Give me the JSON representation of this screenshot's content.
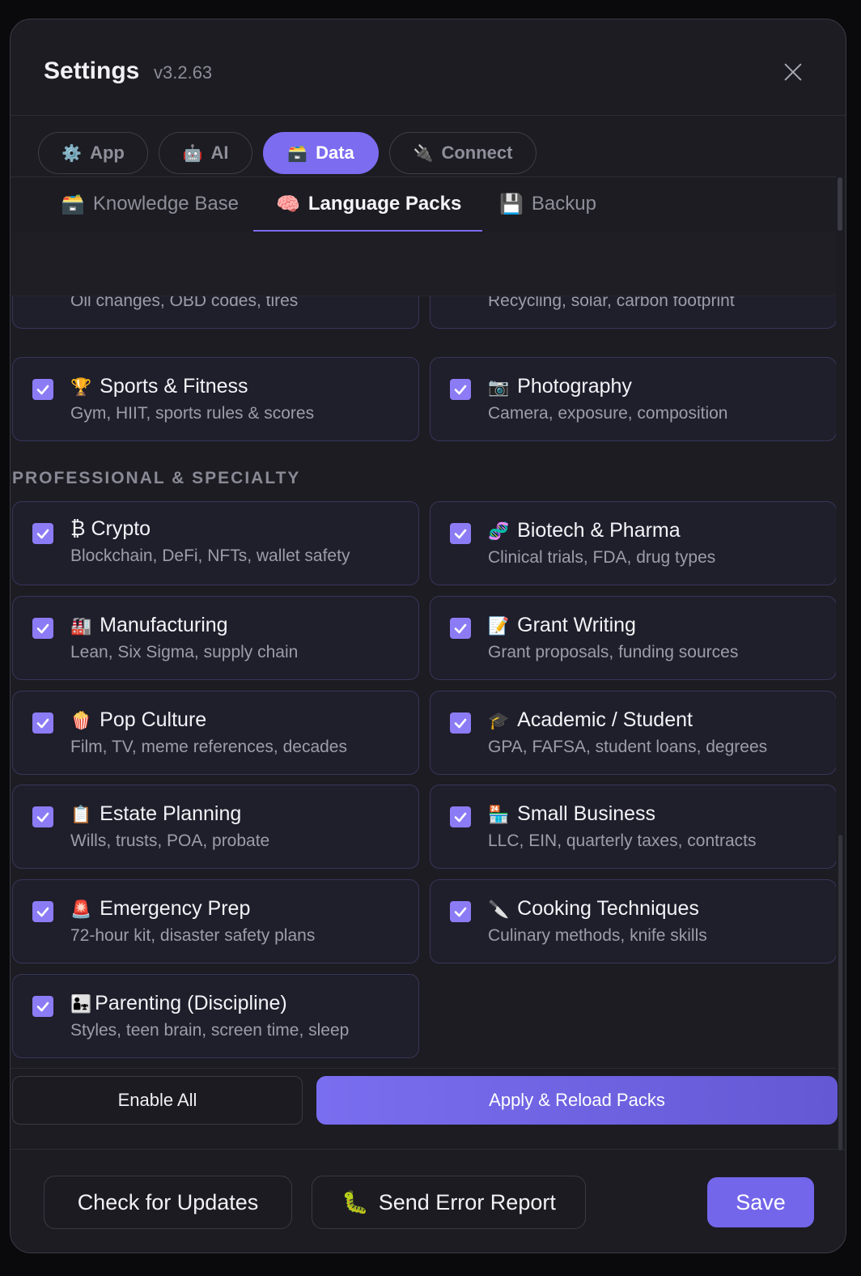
{
  "header": {
    "title": "Settings",
    "version": "v3.2.63"
  },
  "main_tabs": [
    {
      "icon": "⚙️",
      "label": "App"
    },
    {
      "icon": "🤖",
      "label": "AI"
    },
    {
      "icon": "🗃️",
      "label": "Data",
      "active": true
    },
    {
      "icon": "🔌",
      "label": "Connect"
    }
  ],
  "sub_tabs": [
    {
      "icon": "🗃️",
      "label": "Knowledge Base"
    },
    {
      "icon": "🧠",
      "label": "Language Packs",
      "active": true
    },
    {
      "icon": "💾",
      "label": "Backup"
    }
  ],
  "partial_cards": [
    {
      "desc": "Oil changes, OBD codes, tires"
    },
    {
      "desc": "Recycling, solar, carbon footprint"
    }
  ],
  "lifestyle_cards": [
    {
      "emoji": "🏆",
      "title": "Sports & Fitness",
      "desc": "Gym, HIIT, sports rules & scores",
      "checked": true
    },
    {
      "emoji": "📷",
      "title": "Photography",
      "desc": "Camera, exposure, composition",
      "checked": true
    }
  ],
  "section_title": "PROFESSIONAL & SPECIALTY",
  "professional_cards": [
    {
      "emoji": "",
      "title": "₿ Crypto",
      "desc": "Blockchain, DeFi, NFTs, wallet safety",
      "checked": true
    },
    {
      "emoji": "🧬",
      "title": "Biotech & Pharma",
      "desc": "Clinical trials, FDA, drug types",
      "checked": true
    },
    {
      "emoji": "🏭",
      "title": "Manufacturing",
      "desc": "Lean, Six Sigma, supply chain",
      "checked": true
    },
    {
      "emoji": "📝",
      "title": "Grant Writing",
      "desc": "Grant proposals, funding sources",
      "checked": true
    },
    {
      "emoji": "🍿",
      "title": "Pop Culture",
      "desc": "Film, TV, meme references, decades",
      "checked": true
    },
    {
      "emoji": "🎓",
      "title": "Academic / Student",
      "desc": "GPA, FAFSA, student loans, degrees",
      "checked": true
    },
    {
      "emoji": "📋",
      "title": "Estate Planning",
      "desc": "Wills, trusts, POA, probate",
      "checked": true
    },
    {
      "emoji": "🏪",
      "title": "Small Business",
      "desc": "LLC, EIN, quarterly taxes, contracts",
      "checked": true
    },
    {
      "emoji": "🚨",
      "title": "Emergency Prep",
      "desc": "72-hour kit, disaster safety plans",
      "checked": true
    },
    {
      "emoji": "🔪",
      "title": "Cooking Techniques",
      "desc": "Culinary methods, knife skills",
      "checked": true
    },
    {
      "emoji": "👨‍👧",
      "title": "Parenting (Discipline)",
      "desc": "Styles, teen brain, screen time, sleep",
      "checked": true
    }
  ],
  "actions": {
    "enable_all": "Enable All",
    "apply": "Apply & Reload Packs"
  },
  "footer": {
    "check_updates": "Check for Updates",
    "send_report_icon": "🐛",
    "send_report": "Send Error Report",
    "save": "Save"
  },
  "colors": {
    "accent": "#7c6cf0",
    "background": "#1c1c22",
    "card": "#1f1e2b"
  }
}
